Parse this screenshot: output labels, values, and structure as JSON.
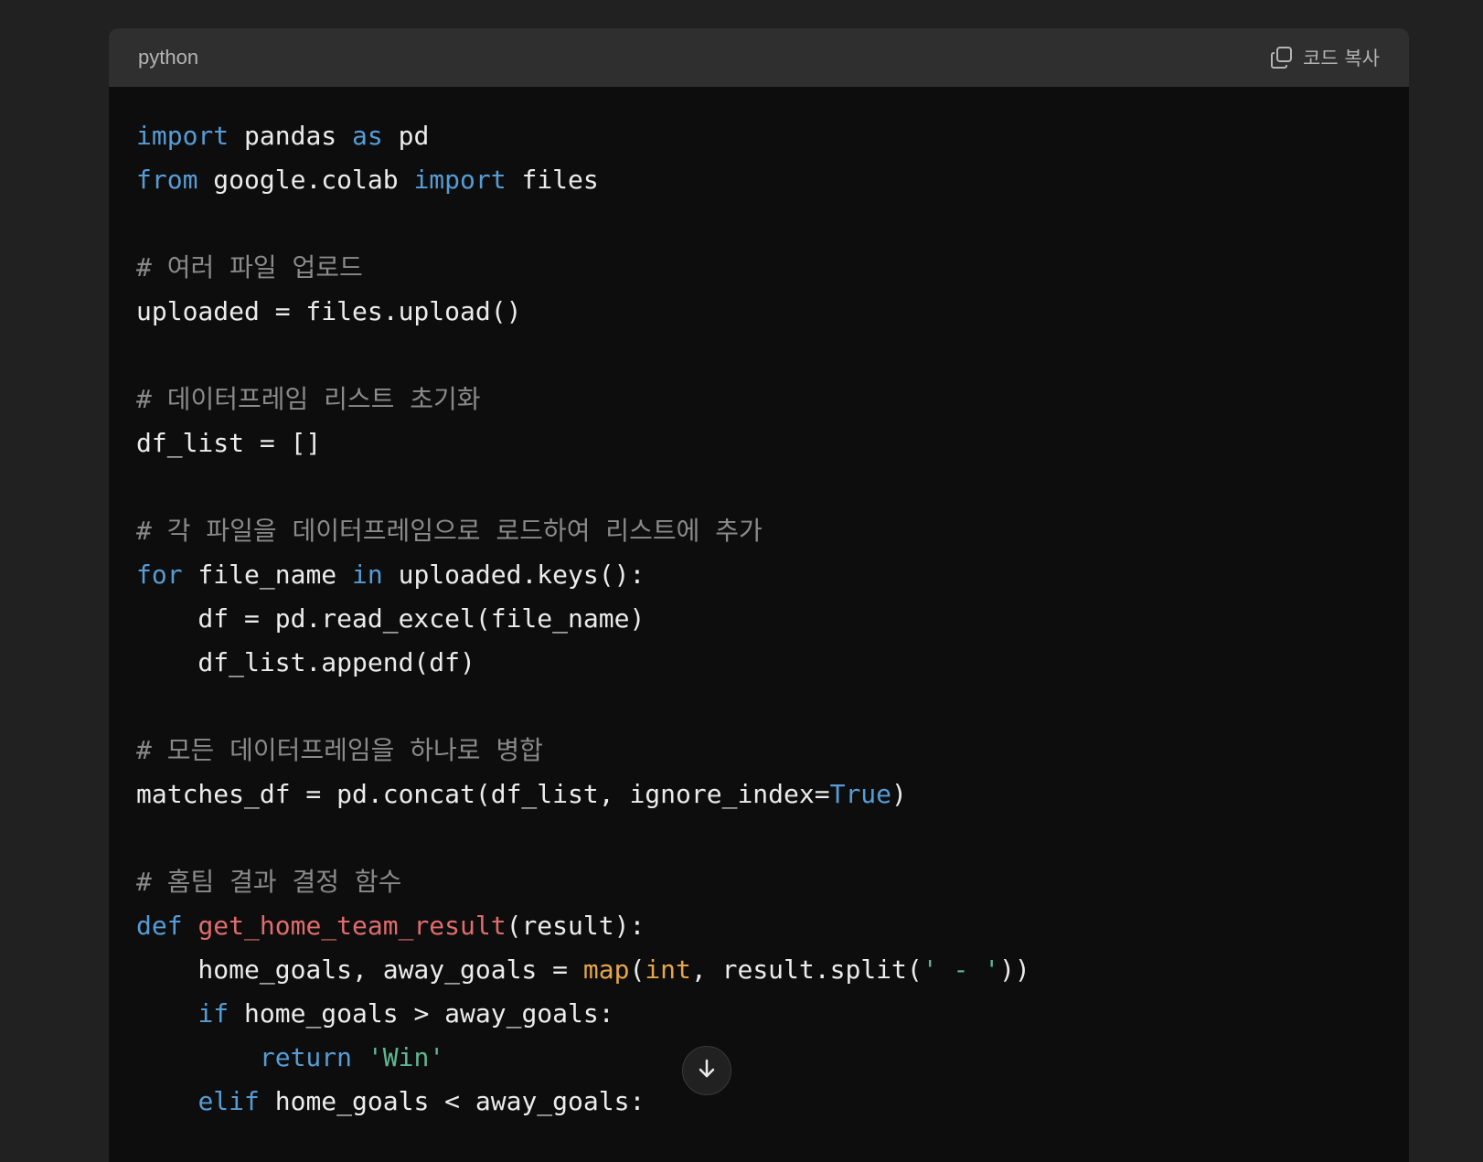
{
  "code_block": {
    "language": "python",
    "copy_label": "코드 복사",
    "copy_icon": "copy-icon",
    "lines": [
      [
        {
          "t": "kw",
          "v": "import"
        },
        {
          "t": "",
          "v": " pandas "
        },
        {
          "t": "kw",
          "v": "as"
        },
        {
          "t": "",
          "v": " pd"
        }
      ],
      [
        {
          "t": "kw",
          "v": "from"
        },
        {
          "t": "",
          "v": " google.colab "
        },
        {
          "t": "kw",
          "v": "import"
        },
        {
          "t": "",
          "v": " files"
        }
      ],
      [],
      [
        {
          "t": "cm",
          "v": "# 여러 파일 업로드"
        }
      ],
      [
        {
          "t": "",
          "v": "uploaded = files.upload()"
        }
      ],
      [],
      [
        {
          "t": "cm",
          "v": "# 데이터프레임 리스트 초기화"
        }
      ],
      [
        {
          "t": "",
          "v": "df_list = []"
        }
      ],
      [],
      [
        {
          "t": "cm",
          "v": "# 각 파일을 데이터프레임으로 로드하여 리스트에 추가"
        }
      ],
      [
        {
          "t": "kw",
          "v": "for"
        },
        {
          "t": "",
          "v": " file_name "
        },
        {
          "t": "kw",
          "v": "in"
        },
        {
          "t": "",
          "v": " uploaded.keys():"
        }
      ],
      [
        {
          "t": "",
          "v": "    df = pd.read_excel(file_name)"
        }
      ],
      [
        {
          "t": "",
          "v": "    df_list.append(df)"
        }
      ],
      [],
      [
        {
          "t": "cm",
          "v": "# 모든 데이터프레임을 하나로 병합"
        }
      ],
      [
        {
          "t": "",
          "v": "matches_df = pd.concat(df_list, ignore_index="
        },
        {
          "t": "kw",
          "v": "True"
        },
        {
          "t": "",
          "v": ")"
        }
      ],
      [],
      [
        {
          "t": "cm",
          "v": "# 홈팀 결과 결정 함수"
        }
      ],
      [
        {
          "t": "kw",
          "v": "def"
        },
        {
          "t": "",
          "v": " "
        },
        {
          "t": "fn",
          "v": "get_home_team_result"
        },
        {
          "t": "",
          "v": "(result):"
        }
      ],
      [
        {
          "t": "",
          "v": "    home_goals, away_goals = "
        },
        {
          "t": "bi",
          "v": "map"
        },
        {
          "t": "",
          "v": "("
        },
        {
          "t": "bi",
          "v": "int"
        },
        {
          "t": "",
          "v": ", result.split("
        },
        {
          "t": "st",
          "v": "' - '"
        },
        {
          "t": "",
          "v": "))"
        }
      ],
      [
        {
          "t": "",
          "v": "    "
        },
        {
          "t": "kw",
          "v": "if"
        },
        {
          "t": "",
          "v": " home_goals > away_goals:"
        }
      ],
      [
        {
          "t": "",
          "v": "        "
        },
        {
          "t": "kw",
          "v": "return"
        },
        {
          "t": "",
          "v": " "
        },
        {
          "t": "st",
          "v": "'Win'"
        }
      ],
      [
        {
          "t": "",
          "v": "    "
        },
        {
          "t": "kw",
          "v": "elif"
        },
        {
          "t": "",
          "v": " home_goals < away_goals:"
        }
      ]
    ]
  },
  "scroll_button_icon": "arrow-down-icon"
}
